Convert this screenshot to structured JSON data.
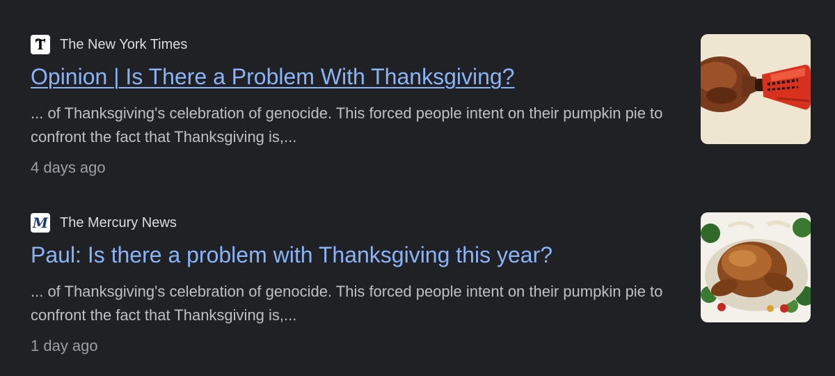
{
  "results": [
    {
      "source": "The New York Times",
      "source_icon": "nyt-logo-icon",
      "title": "Opinion | Is There a Problem With Thanksgiving?",
      "snippet": "... of Thanksgiving's celebration of genocide. This forced people intent on their pumpkin pie to confront the fact that Thanksgiving is,...",
      "age": "4 days ago",
      "thumbnail": "turkey-leg-in-oven-mitt-image"
    },
    {
      "source": "The Mercury News",
      "source_icon": "mercury-news-logo-icon",
      "title": "Paul: Is there a problem with Thanksgiving this year?",
      "snippet": "... of Thanksgiving's celebration of genocide. This forced people intent on their pumpkin pie to confront the fact that Thanksgiving is,...",
      "age": "1 day ago",
      "thumbnail": "roast-turkey-platter-image"
    }
  ],
  "colors": {
    "background": "#202124",
    "title_link": "#8ab4f8",
    "snippet_text": "#bdc1c6",
    "meta_text": "#9aa0a6",
    "source_text": "#dadce0"
  }
}
